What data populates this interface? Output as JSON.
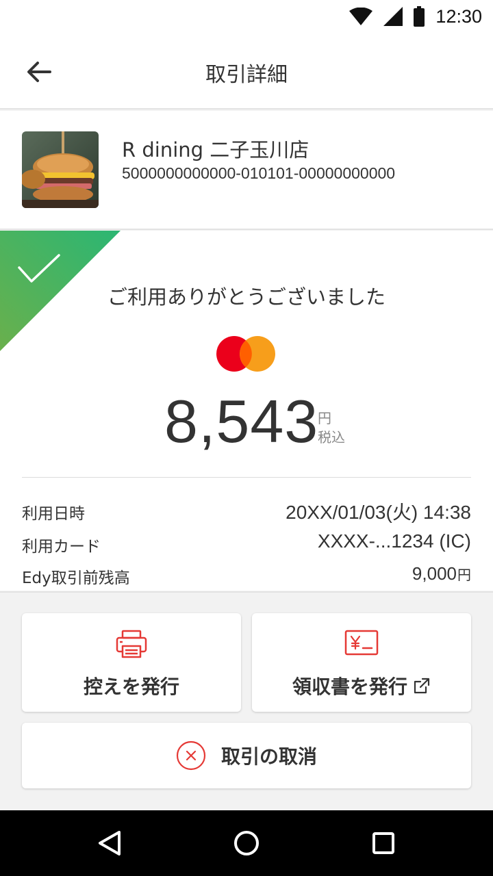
{
  "status_bar": {
    "time": "12:30"
  },
  "header": {
    "title": "取引詳細"
  },
  "merchant": {
    "name": "R dining 二子玉川店",
    "transaction_id": "5000000000000-010101-00000000000"
  },
  "receipt": {
    "thanks_message": "ご利用ありがとうございました",
    "amount": "8,543",
    "currency_unit": "円",
    "tax_note": "税込",
    "details": [
      {
        "label": "利用日時",
        "value": "20XX/01/03(火) 14:38"
      },
      {
        "label": "利用カード",
        "value": "XXXX-...1234 (IC)"
      },
      {
        "label": "Edy取引前残高",
        "value": "9,000",
        "unit": "円"
      }
    ]
  },
  "actions": {
    "print_copy": "控えを発行",
    "issue_receipt": "領収書を発行",
    "cancel_transaction": "取引の取消"
  },
  "colors": {
    "accent_red": "#e53935",
    "success_green_start": "#6ab04c",
    "success_green_end": "#2bb673",
    "mastercard_red": "#eb001b",
    "mastercard_orange": "#f79e1b"
  },
  "icons": {
    "back": "arrow-left-icon",
    "print": "printer-icon",
    "receipt": "yen-receipt-icon",
    "external": "external-link-icon",
    "cancel": "close-circle-icon"
  }
}
